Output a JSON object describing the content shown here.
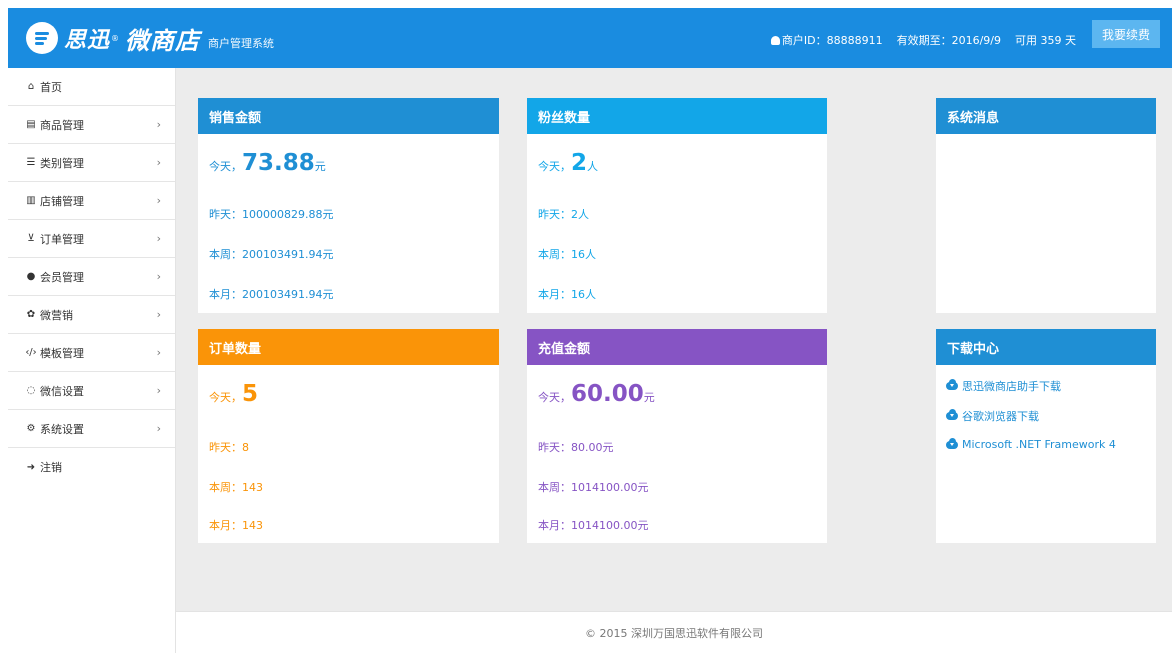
{
  "header": {
    "brand_main": "思迅",
    "brand_mark": "®",
    "brand_name": "微商店",
    "brand_sub": "商户管理系统",
    "merchant_id_label": "商户ID：88888911",
    "expiry_label": "有效期至：2016/9/9",
    "days_left_label": "可用 359 天",
    "renew_button": "我要续费",
    "accent_color": "#1a8ce0"
  },
  "sidebar": {
    "items": [
      {
        "icon": "home-icon",
        "label": "首页",
        "has_chevron": false
      },
      {
        "icon": "product-icon",
        "label": "商品管理",
        "has_chevron": true
      },
      {
        "icon": "list-icon",
        "label": "类别管理",
        "has_chevron": true
      },
      {
        "icon": "bank-icon",
        "label": "店铺管理",
        "has_chevron": true
      },
      {
        "icon": "cart-icon",
        "label": "订单管理",
        "has_chevron": true
      },
      {
        "icon": "user-icon",
        "label": "会员管理",
        "has_chevron": true
      },
      {
        "icon": "gift-icon",
        "label": "微营销",
        "has_chevron": true
      },
      {
        "icon": "code-icon",
        "label": "模板管理",
        "has_chevron": true
      },
      {
        "icon": "chat-icon",
        "label": "微信设置",
        "has_chevron": true
      },
      {
        "icon": "cogs-icon",
        "label": "系统设置",
        "has_chevron": true
      },
      {
        "icon": "logout-icon",
        "label": "注销",
        "has_chevron": false
      }
    ],
    "chevron": "›"
  },
  "cards": {
    "sales": {
      "title": "销售金额",
      "today_label": "今天，",
      "today_value": "73.88",
      "today_unit": "元",
      "yesterday": "昨天：100000829.88元",
      "week": "本周：200103491.94元",
      "month": "本月：200103491.94元",
      "color": "#1f8fd4"
    },
    "fans": {
      "title": "粉丝数量",
      "today_label": "今天，",
      "today_value": "2",
      "today_unit": "人",
      "yesterday": "昨天：2人",
      "week": "本周：16人",
      "month": "本月：16人",
      "color": "#12a6e8"
    },
    "orders": {
      "title": "订单数量",
      "today_label": "今天，",
      "today_value": "5",
      "today_unit": "",
      "yesterday": "昨天：8",
      "week": "本周：143",
      "month": "本月：143",
      "color": "#fa9408"
    },
    "recharge": {
      "title": "充值金额",
      "today_label": "今天，",
      "today_value": "60.00",
      "today_unit": "元",
      "yesterday": "昨天：80.00元",
      "week": "本周：1014100.00元",
      "month": "本月：1014100.00元",
      "color": "#8654c4"
    },
    "system": {
      "title": "系统消息"
    },
    "downloads": {
      "title": "下载中心",
      "items": [
        "思迅微商店助手下载",
        "谷歌浏览器下载",
        "Microsoft .NET Framework 4"
      ]
    }
  },
  "footer": {
    "copyright": "© 2015 深圳万国思迅软件有限公司"
  }
}
